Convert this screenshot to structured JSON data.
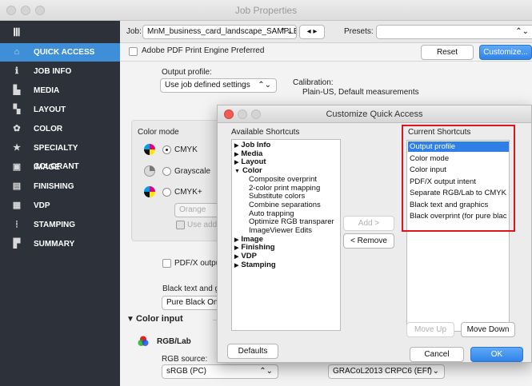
{
  "window": {
    "title": "Job Properties"
  },
  "dialog": {
    "title": "Customize Quick Access",
    "available_label": "Available Shortcuts",
    "current_label": "Current Shortcuts",
    "tree": [
      {
        "label": "Job Info",
        "bold": true,
        "arrow": "▶",
        "indent": 0
      },
      {
        "label": "Media",
        "bold": true,
        "arrow": "▶",
        "indent": 0
      },
      {
        "label": "Layout",
        "bold": true,
        "arrow": "▶",
        "indent": 0
      },
      {
        "label": "Color",
        "bold": true,
        "arrow": "▼",
        "indent": 0
      },
      {
        "label": "Composite overprint",
        "bold": false,
        "arrow": "",
        "indent": 1
      },
      {
        "label": "2-color print mapping",
        "bold": false,
        "arrow": "",
        "indent": 1
      },
      {
        "label": "Substitute colors",
        "bold": false,
        "arrow": "",
        "indent": 1
      },
      {
        "label": "Combine separations",
        "bold": false,
        "arrow": "",
        "indent": 1
      },
      {
        "label": "Auto trapping",
        "bold": false,
        "arrow": "",
        "indent": 1
      },
      {
        "label": "Optimize RGB transparer",
        "bold": false,
        "arrow": "",
        "indent": 1
      },
      {
        "label": "ImageViewer Edits",
        "bold": false,
        "arrow": "",
        "indent": 1
      },
      {
        "label": "Image",
        "bold": true,
        "arrow": "▶",
        "indent": 0
      },
      {
        "label": "Finishing",
        "bold": true,
        "arrow": "▶",
        "indent": 0
      },
      {
        "label": "VDP",
        "bold": true,
        "arrow": "▶",
        "indent": 0
      },
      {
        "label": "Stamping",
        "bold": true,
        "arrow": "▶",
        "indent": 0
      }
    ],
    "current": [
      "Output profile",
      "Color mode",
      "Color input",
      "PDF/X output intent",
      "Separate RGB/Lab to CMYK s",
      "Black text and graphics",
      "Black overprint (for pure blac"
    ],
    "add_label": "Add >",
    "remove_label": "< Remove",
    "move_up_label": "Move Up",
    "move_down_label": "Move Down",
    "defaults_label": "Defaults",
    "cancel_label": "Cancel",
    "ok_label": "OK"
  },
  "sidebar": {
    "items": [
      {
        "label": "QUICK ACCESS",
        "icon": "home-icon",
        "glyph": "⌂",
        "active": true
      },
      {
        "label": "JOB INFO",
        "icon": "info-icon",
        "glyph": "ℹ",
        "active": false
      },
      {
        "label": "MEDIA",
        "icon": "media-icon",
        "glyph": "▙",
        "active": false
      },
      {
        "label": "LAYOUT",
        "icon": "layout-icon",
        "glyph": "▚",
        "active": false
      },
      {
        "label": "COLOR",
        "icon": "palette-icon",
        "glyph": "✿",
        "active": false
      },
      {
        "label": "SPECIALTY COLORANT",
        "icon": "star-icon",
        "glyph": "★",
        "active": false
      },
      {
        "label": "IMAGE",
        "icon": "image-icon",
        "glyph": "▣",
        "active": false
      },
      {
        "label": "FINISHING",
        "icon": "finishing-icon",
        "glyph": "▤",
        "active": false
      },
      {
        "label": "VDP",
        "icon": "vdp-icon",
        "glyph": "▦",
        "active": false
      },
      {
        "label": "STAMPING",
        "icon": "stamping-icon",
        "glyph": "⦙",
        "active": false
      },
      {
        "label": "SUMMARY",
        "icon": "summary-icon",
        "glyph": "▛",
        "active": false
      }
    ]
  },
  "header": {
    "job_label": "Job:",
    "job_value": "MnM_business_card_landscape_SAMPLE.pdf",
    "presets_label": "Presets:",
    "presets_value": ""
  },
  "quick": {
    "adobe_label": "Adobe PDF Print Engine Preferred",
    "reset_label": "Reset",
    "customize_label": "Customize...",
    "output_profile_label": "Output profile:",
    "output_profile_value": "Use job defined settings",
    "calibration_label": "Calibration:",
    "calibration_value": "Plain-US, Default measurements",
    "color_mode_label": "Color mode",
    "cmyk_label": "CMYK",
    "grayscale_label": "Grayscale",
    "cmykplus_label": "CMYK+",
    "orange_value": "Orange",
    "use_addl_label": "Use additi",
    "pdfx_label": "PDF/X output",
    "black_text_label": "Black text and gr",
    "black_text_value": "Pure Black On",
    "color_input_label": "Color input",
    "rgb_lab_label": "RGB/Lab",
    "rgb_source_label": "RGB source:",
    "rgb_source_value": "sRGB (PC)",
    "gracol_value": "GRACoL2013 CRPC6 (EFI)"
  },
  "colors": {
    "accent": "#3e8fd8",
    "sidebar": "#2c313a",
    "highlight_box": "#e0141e"
  }
}
